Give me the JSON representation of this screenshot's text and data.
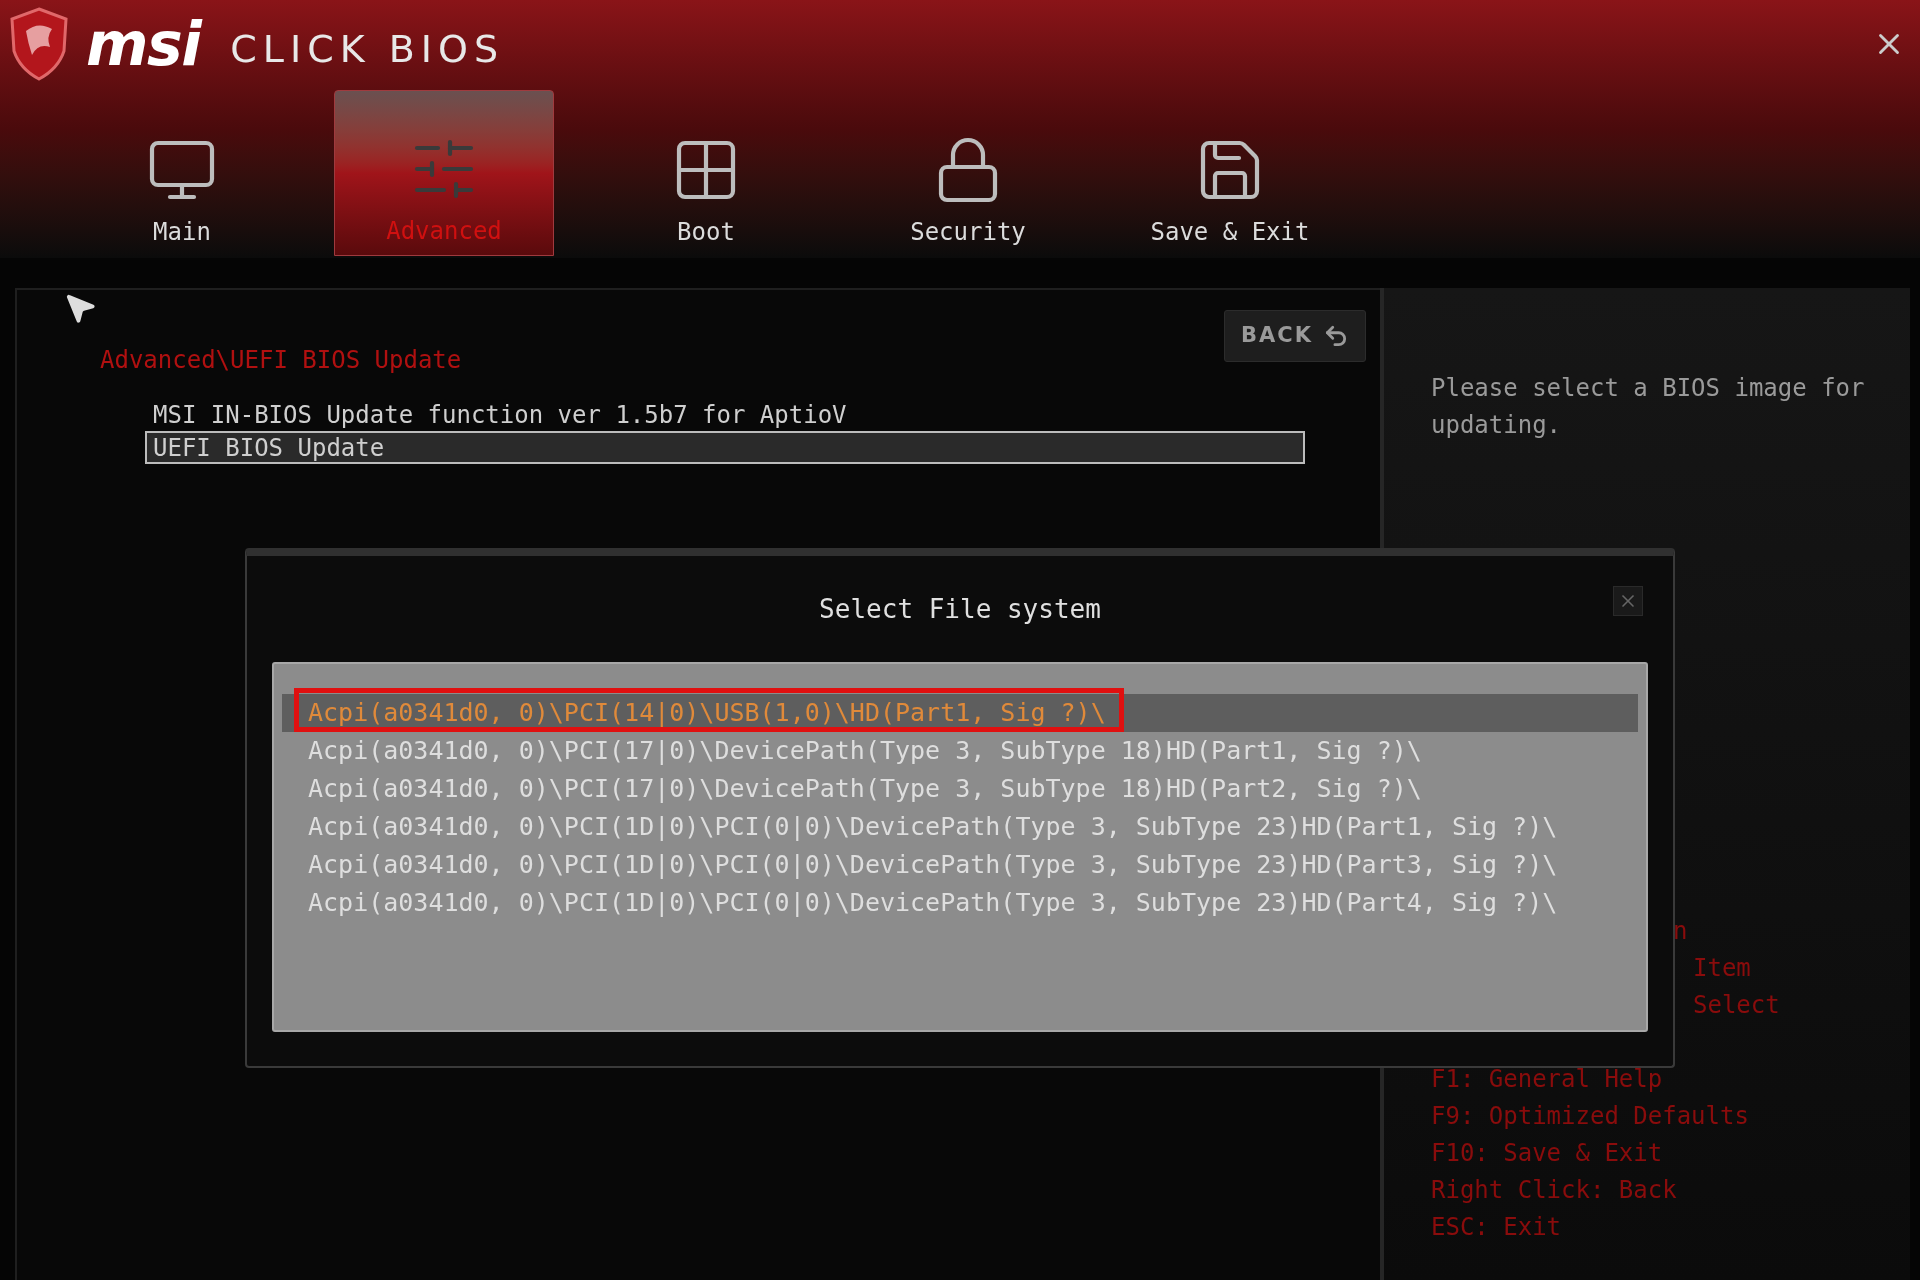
{
  "brand": {
    "logo": "msi",
    "product": "CLICK BIOS"
  },
  "tabs": [
    {
      "label": "Main",
      "selected": false
    },
    {
      "label": "Advanced",
      "selected": true
    },
    {
      "label": "Boot",
      "selected": false
    },
    {
      "label": "Security",
      "selected": false
    },
    {
      "label": "Save & Exit",
      "selected": false
    }
  ],
  "content": {
    "breadcrumb": "Advanced\\UEFI BIOS Update",
    "back_button": "BACK",
    "items": [
      {
        "label": "MSI IN-BIOS Update function ver 1.5b7 for AptioV",
        "selected": false
      },
      {
        "label": "UEFI BIOS Update",
        "selected": true
      }
    ]
  },
  "help_panel": {
    "description": "Please select a BIOS image for updating.",
    "partial_lines": [
      "n",
      "Item",
      "Select"
    ],
    "keys": [
      "F1: General Help",
      "F9: Optimized Defaults",
      "F10: Save & Exit",
      "Right Click: Back",
      "ESC: Exit"
    ]
  },
  "dialog": {
    "title": "Select File system",
    "items": [
      {
        "label": "Acpi(a0341d0, 0)\\PCI(14|0)\\USB(1,0)\\HD(Part1, Sig ?)\\",
        "selected": true,
        "highlighted": true
      },
      {
        "label": "Acpi(a0341d0, 0)\\PCI(17|0)\\DevicePath(Type 3, SubType 18)HD(Part1, Sig ?)\\",
        "selected": false,
        "highlighted": false
      },
      {
        "label": "Acpi(a0341d0, 0)\\PCI(17|0)\\DevicePath(Type 3, SubType 18)HD(Part2, Sig ?)\\",
        "selected": false,
        "highlighted": false
      },
      {
        "label": "Acpi(a0341d0, 0)\\PCI(1D|0)\\PCI(0|0)\\DevicePath(Type 3, SubType 23)HD(Part1, Sig ?)\\",
        "selected": false,
        "highlighted": false
      },
      {
        "label": "Acpi(a0341d0, 0)\\PCI(1D|0)\\PCI(0|0)\\DevicePath(Type 3, SubType 23)HD(Part3, Sig ?)\\",
        "selected": false,
        "highlighted": false
      },
      {
        "label": "Acpi(a0341d0, 0)\\PCI(1D|0)\\PCI(0|0)\\DevicePath(Type 3, SubType 23)HD(Part4, Sig ?)\\",
        "selected": false,
        "highlighted": false
      }
    ]
  }
}
